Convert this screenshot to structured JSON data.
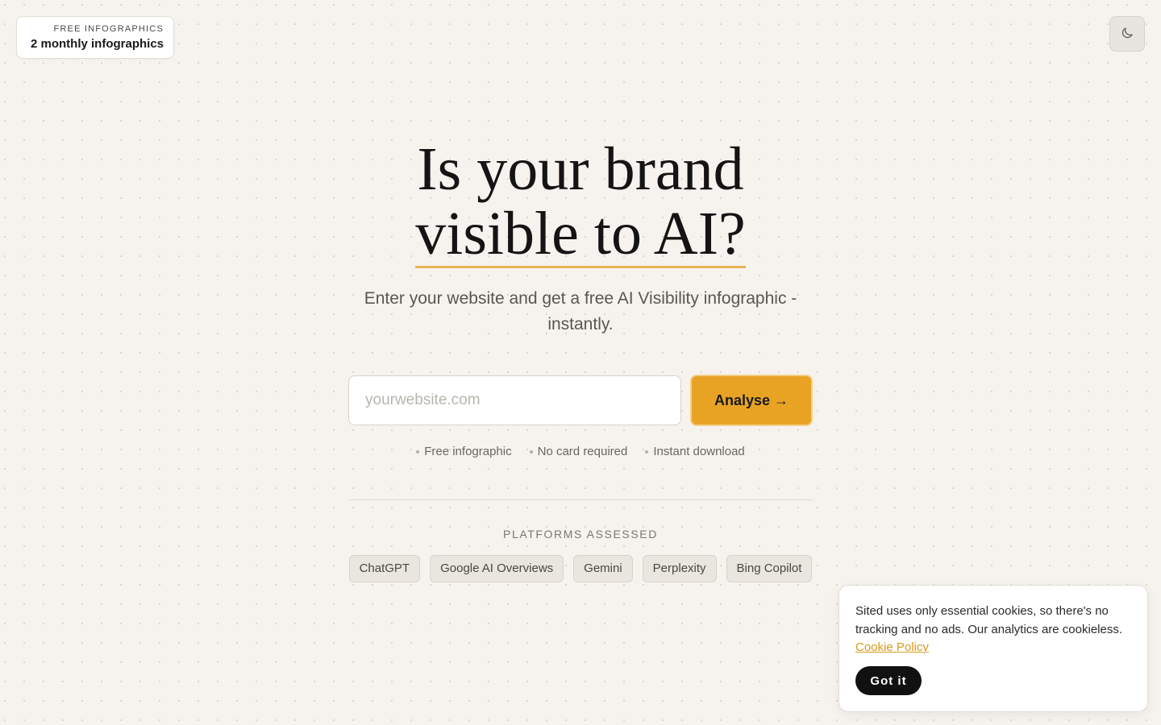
{
  "quota": {
    "kicker": "FREE INFOGRAPHICS",
    "value": "2 monthly infographics"
  },
  "theme_toggle": {
    "icon": "moon-icon"
  },
  "hero": {
    "headline_line1": "Is your brand",
    "headline_line2": "visible to AI?",
    "subtitle": "Enter your website and get a free AI Visibility infographic - instantly."
  },
  "search": {
    "placeholder": "yourwebsite.com",
    "value": "",
    "button_label": "Analyse →"
  },
  "perks": [
    "Free infographic",
    "No card required",
    "Instant download"
  ],
  "platforms": {
    "label": "PLATFORMS ASSESSED",
    "items": [
      "ChatGPT",
      "Google AI Overviews",
      "Gemini",
      "Perplexity",
      "Bing Copilot"
    ]
  },
  "cookie": {
    "text": "Sited uses only essential cookies, so there's no tracking and no ads. Our analytics are cookieless.",
    "link_label": "Cookie Policy",
    "button_label": "Got it"
  },
  "colors": {
    "background": "#f6f3ee",
    "accent": "#e8a325",
    "underline": "#e8b656",
    "link": "#d79a1a",
    "dark_button": "#111111"
  }
}
